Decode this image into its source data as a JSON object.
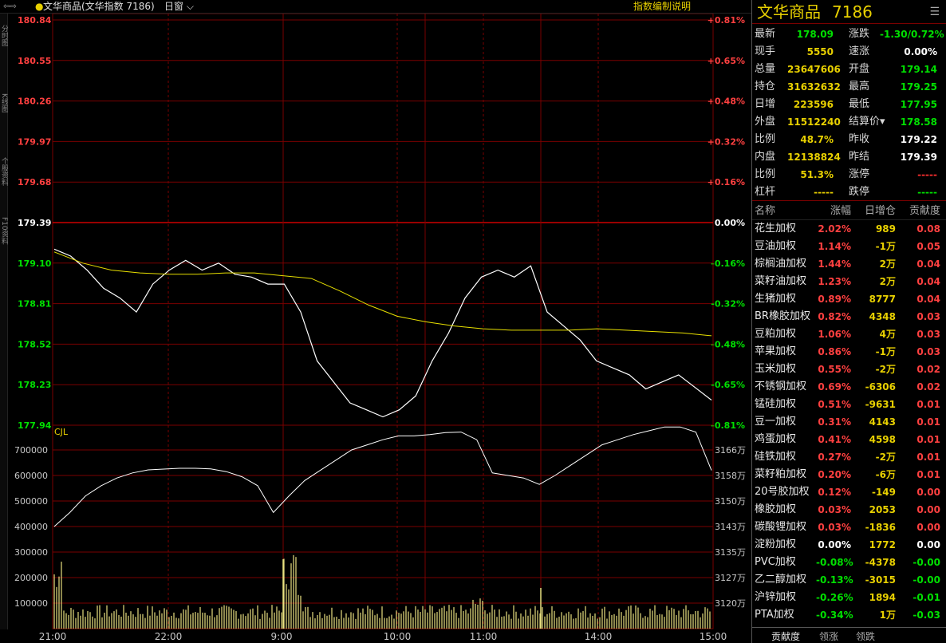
{
  "topbar": {
    "nav_icon": "⇦⇨",
    "title": "文华商品(文华指数 7186)",
    "period": "日窗",
    "explain": "指数编制说明"
  },
  "left_tabs": [
    "分时图",
    "K线图",
    "个股资料",
    "F10资料"
  ],
  "chart": {
    "price_axis": [
      "180.84",
      "180.55",
      "180.26",
      "179.97",
      "179.68",
      "179.39",
      "179.10",
      "178.81",
      "178.52",
      "178.23",
      "177.94"
    ],
    "pct_axis": [
      "+0.81%",
      "+0.65%",
      "+0.48%",
      "+0.32%",
      "+0.16%",
      "0.00%",
      "-0.16%",
      "-0.32%",
      "-0.48%",
      "-0.65%",
      "-0.81%"
    ],
    "vol_axis": [
      "700000",
      "600000",
      "500000",
      "400000",
      "300000",
      "200000",
      "100000"
    ],
    "oi_axis": [
      "3166万",
      "3158万",
      "3150万",
      "3143万",
      "3135万",
      "3127万",
      "3120万"
    ],
    "time_labels": [
      "21:00",
      "22:00",
      "9:00",
      "10:00",
      "11:00",
      "14:00",
      "15:00"
    ],
    "vol_label": "CJL"
  },
  "chart_data": {
    "type": "line",
    "x": [
      "21:00",
      "22:00",
      "9:00",
      "10:00",
      "11:00",
      "14:00",
      "15:00"
    ],
    "prev_settle": 179.39,
    "ylim": [
      177.94,
      180.84
    ],
    "series": [],
    "price_points": [
      179.2,
      179.15,
      179.05,
      178.92,
      178.85,
      178.75,
      178.95,
      179.05,
      179.12,
      179.05,
      179.1,
      179.02,
      179.0,
      178.95,
      178.95,
      178.75,
      178.4,
      178.25,
      178.1,
      178.05,
      178.0,
      178.05,
      178.15,
      178.4,
      178.6,
      178.85,
      179.0,
      179.05,
      179.0,
      179.08,
      178.75,
      178.65,
      178.55,
      178.4,
      178.35,
      178.3,
      178.2,
      178.25,
      178.3,
      178.21,
      178.12
    ],
    "avg_points": [
      179.18,
      179.1,
      179.05,
      179.03,
      179.02,
      179.02,
      179.03,
      179.03,
      179.01,
      178.99,
      178.9,
      178.8,
      178.72,
      178.68,
      178.65,
      178.63,
      178.62,
      178.62,
      178.62,
      178.63,
      178.62,
      178.61,
      178.6,
      178.58
    ]
  },
  "quote": {
    "name": "文华商品",
    "code": "7186",
    "menu_icon": "☰",
    "rows": [
      {
        "l1": "最新",
        "v1": "178.09",
        "c1": "down",
        "l2": "涨跌",
        "v2": "-1.30/0.72%",
        "c2": "down"
      },
      {
        "l1": "现手",
        "v1": "5550",
        "c1": "yellow",
        "l2": "速涨",
        "v2": "0.00%",
        "c2": "white"
      },
      {
        "l1": "总量",
        "v1": "23647606",
        "c1": "yellow",
        "l2": "开盘",
        "v2": "179.14",
        "c2": "down"
      },
      {
        "l1": "持仓",
        "v1": "31632632",
        "c1": "yellow",
        "l2": "最高",
        "v2": "179.25",
        "c2": "down"
      },
      {
        "l1": "日增",
        "v1": "223596",
        "c1": "yellow",
        "l2": "最低",
        "v2": "177.95",
        "c2": "down"
      },
      {
        "l1": "外盘",
        "v1": "11512240",
        "c1": "yellow",
        "l2": "结算价▾",
        "v2": "178.58",
        "c2": "down"
      },
      {
        "l1": "比例",
        "v1": "48.7%",
        "c1": "yellow",
        "l2": "昨收",
        "v2": "179.22",
        "c2": "white"
      },
      {
        "l1": "内盘",
        "v1": "12138824",
        "c1": "yellow",
        "l2": "昨结",
        "v2": "179.39",
        "c2": "white"
      },
      {
        "l1": "比例",
        "v1": "51.3%",
        "c1": "yellow",
        "l2": "涨停",
        "v2": "-----",
        "c2": "red"
      },
      {
        "l1": "杠杆",
        "v1": "-----",
        "c1": "yellow",
        "l2": "跌停",
        "v2": "-----",
        "c2": "down"
      }
    ]
  },
  "list": {
    "headers": {
      "name": "名称",
      "chg": "涨幅",
      "pos": "日增仓",
      "con": "贡献度"
    },
    "rows": [
      {
        "name": "花生加权",
        "chg": "2.02%",
        "pos": "989",
        "con": "0.08",
        "dir": "up"
      },
      {
        "name": "豆油加权",
        "chg": "1.14%",
        "pos": "-1万",
        "con": "0.05",
        "dir": "up"
      },
      {
        "name": "棕榈油加权",
        "chg": "1.44%",
        "pos": "2万",
        "con": "0.04",
        "dir": "up"
      },
      {
        "name": "菜籽油加权",
        "chg": "1.23%",
        "pos": "2万",
        "con": "0.04",
        "dir": "up"
      },
      {
        "name": "生猪加权",
        "chg": "0.89%",
        "pos": "8777",
        "con": "0.04",
        "dir": "up"
      },
      {
        "name": "BR橡胶加权",
        "chg": "0.82%",
        "pos": "4348",
        "con": "0.03",
        "dir": "up"
      },
      {
        "name": "豆粕加权",
        "chg": "1.06%",
        "pos": "4万",
        "con": "0.03",
        "dir": "up"
      },
      {
        "name": "苹果加权",
        "chg": "0.86%",
        "pos": "-1万",
        "con": "0.03",
        "dir": "up"
      },
      {
        "name": "玉米加权",
        "chg": "0.55%",
        "pos": "-2万",
        "con": "0.02",
        "dir": "up"
      },
      {
        "name": "不锈钢加权",
        "chg": "0.69%",
        "pos": "-6306",
        "con": "0.02",
        "dir": "up"
      },
      {
        "name": "锰硅加权",
        "chg": "0.51%",
        "pos": "-9631",
        "con": "0.01",
        "dir": "up"
      },
      {
        "name": "豆一加权",
        "chg": "0.31%",
        "pos": "4143",
        "con": "0.01",
        "dir": "up"
      },
      {
        "name": "鸡蛋加权",
        "chg": "0.41%",
        "pos": "4598",
        "con": "0.01",
        "dir": "up"
      },
      {
        "name": "硅铁加权",
        "chg": "0.27%",
        "pos": "-2万",
        "con": "0.01",
        "dir": "up"
      },
      {
        "name": "菜籽粕加权",
        "chg": "0.20%",
        "pos": "-6万",
        "con": "0.01",
        "dir": "up"
      },
      {
        "name": "20号胶加权",
        "chg": "0.12%",
        "pos": "-149",
        "con": "0.00",
        "dir": "up"
      },
      {
        "name": "橡胶加权",
        "chg": "0.03%",
        "pos": "2053",
        "con": "0.00",
        "dir": "up"
      },
      {
        "name": "碳酸锂加权",
        "chg": "0.03%",
        "pos": "-1836",
        "con": "0.00",
        "dir": "up"
      },
      {
        "name": "淀粉加权",
        "chg": "0.00%",
        "pos": "1772",
        "con": "0.00",
        "dir": "flat"
      },
      {
        "name": "PVC加权",
        "chg": "-0.08%",
        "pos": "-4378",
        "con": "-0.00",
        "dir": "down"
      },
      {
        "name": "乙二醇加权",
        "chg": "-0.13%",
        "pos": "-3015",
        "con": "-0.00",
        "dir": "down"
      },
      {
        "name": "沪锌加权",
        "chg": "-0.26%",
        "pos": "1894",
        "con": "-0.01",
        "dir": "down"
      },
      {
        "name": "PTA加权",
        "chg": "-0.34%",
        "pos": "1万",
        "con": "-0.03",
        "dir": "down"
      }
    ]
  },
  "bottom_tabs": [
    "贡献度",
    "领涨",
    "领跌"
  ]
}
